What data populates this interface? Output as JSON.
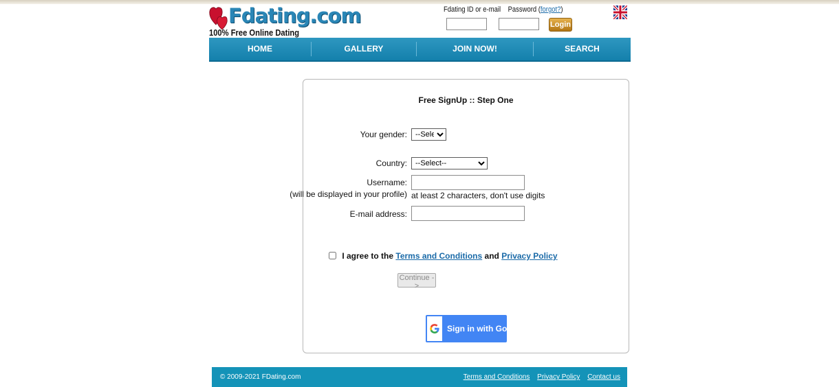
{
  "header": {
    "logo_text": "Fdating.com",
    "tagline": "100% Free Online Dating",
    "login_id_label": "Fdating ID or e-mail",
    "password_label": "Password",
    "forgot_link": "forgot?",
    "login_button": "Login",
    "language_icon": "uk-flag-icon"
  },
  "nav": {
    "items": [
      {
        "label": "HOME"
      },
      {
        "label": "GALLERY"
      },
      {
        "label": "JOIN NOW!"
      },
      {
        "label": "SEARCH"
      }
    ]
  },
  "form": {
    "title": "Free SignUp :: Step One",
    "gender_label": "Your gender:",
    "gender_value": "--Select--",
    "country_label": "Country:",
    "country_value": "--Select--",
    "username_label": "Username:",
    "username_sublabel": "(will be displayed in your profile)",
    "username_value": "",
    "username_hint": "at least 2 characters, don't use digits",
    "email_label": "E-mail address:",
    "email_value": "",
    "agree_prefix": "I agree to the",
    "terms_link": "Terms and Conditions",
    "agree_and": "and",
    "privacy_link": "Privacy Policy",
    "agree_checked": false,
    "continue_button": "Continue ->",
    "google_button": "Sign in with Google"
  },
  "footer": {
    "copyright": "© 2009-2021 FDating.com",
    "links": [
      {
        "label": "Terms and Conditions"
      },
      {
        "label": "Privacy Policy"
      },
      {
        "label": "Contact us"
      }
    ]
  },
  "colors": {
    "nav": "#1a8ab6",
    "footer": "#1493b8",
    "link": "#1a6aa8",
    "google": "#4285f4",
    "login_button": "#cd9331"
  }
}
